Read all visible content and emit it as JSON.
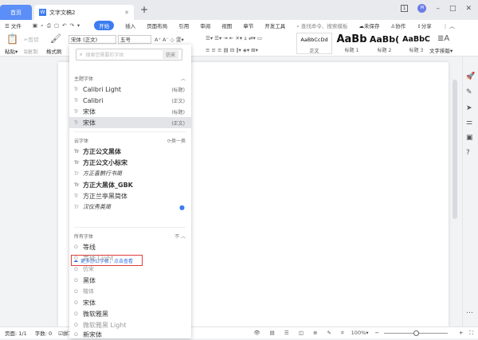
{
  "titlebar": {
    "home_tab": "首页",
    "doc_tab": "文字文稿2",
    "doc_icon": "W",
    "avatar": "M",
    "badge": "1"
  },
  "menu": {
    "file": "文件",
    "items": [
      "开始",
      "插入",
      "页面布局",
      "引用",
      "审阅",
      "视图",
      "章节",
      "开发工具"
    ],
    "search": "查找命令、搜索模板",
    "unsaved": "未保存",
    "collab": "协作",
    "share": "分享"
  },
  "ribbon": {
    "paste": "粘贴",
    "cut": "剪切",
    "copy": "复制",
    "format_painter": "格式刷",
    "font": "宋体 (正文)",
    "size": "五号",
    "styles": [
      {
        "preview": "AaBbCcDd",
        "label": "正文"
      },
      {
        "preview": "AaBb",
        "label": "标题 1"
      },
      {
        "preview": "AaBb(",
        "label": "标题 2"
      },
      {
        "preview": "AaBbC",
        "label": "标题 3"
      }
    ],
    "text_layout": "文字排版"
  },
  "font_dropdown": {
    "search_placeholder": "搜索您需要的字体",
    "search_btn": "仿宋",
    "theme_title": "主题字体",
    "theme_fonts": [
      {
        "name": "Calibri Light",
        "tag": "(标题)"
      },
      {
        "name": "Calibri",
        "tag": "(正文)"
      },
      {
        "name": "宋体",
        "tag": "(标题)"
      },
      {
        "name": "宋体",
        "tag": "(正文)"
      }
    ],
    "cloud_title": "云字体",
    "refresh": "换一换",
    "cloud_fonts": [
      "方正公文黑体",
      "方正公文小标宋",
      "方正喜鹊行书简",
      "方正大黑体_GBK",
      "方正兰亭黑简体",
      "汉仪秀英简"
    ],
    "more_link": "更多办公字体，点击查看",
    "all_title": "所有字体",
    "all_toggle": "不",
    "all_fonts": [
      "等线",
      "等线 Light",
      "仿宋",
      "黑体",
      "楷体",
      "宋体",
      "微软雅黑",
      "微软雅黑 Light",
      "新宋体"
    ]
  },
  "status": {
    "page": "页面: 1/1",
    "words": "字数: 0",
    "spell": "拼写检查",
    "zoom": "100%",
    "zoom_fraction": 0.5
  }
}
